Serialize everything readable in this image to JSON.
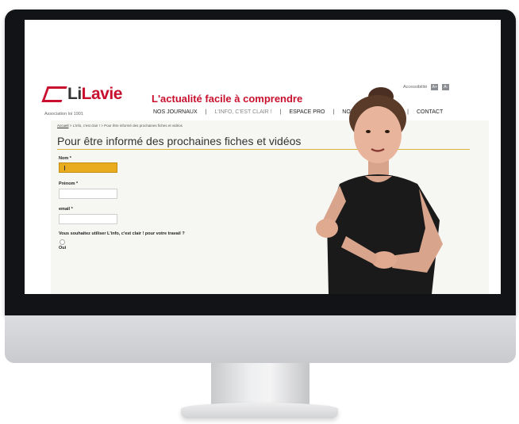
{
  "site": {
    "logo_li": "Li",
    "logo_lavie": "Lavie",
    "association": "Association loi 1901",
    "tagline": "L'actualité facile à comprendre",
    "accessibility_label": "Accessibilité",
    "a_larger": "A+",
    "a_smaller": "A-"
  },
  "nav": {
    "items": [
      "NOS JOURNAUX",
      "L'INFO, C'EST CLAIR !",
      "ESPACE PRO",
      "NOTR",
      "CONTACT"
    ],
    "separator": "|"
  },
  "breadcrumb": {
    "home": "Accueil",
    "section": "L'info, c'est clair !",
    "current": "Pour être informé des prochaines fiches et vidéos",
    "separator": ">"
  },
  "page": {
    "title": "Pour être informé des prochaines fiches et vidéos"
  },
  "form": {
    "nom_label": "Nom *",
    "prenom_label": "Prénom *",
    "email_label": "email *",
    "question": "Vous souhaitez utiliser L'info, c'est clair ! pour votre travail ?",
    "oui_label": "Oui",
    "nom_value": "",
    "prenom_value": "",
    "email_value": ""
  },
  "colors": {
    "brand_red": "#c8102e",
    "focus_yellow": "#e8ac1e",
    "gold_rule": "#d7b53a",
    "signer_shirt": "#1a1a1a"
  },
  "icons": {
    "logo": "lilavie-logo-mark",
    "signer": "sign-language-interpreter"
  }
}
